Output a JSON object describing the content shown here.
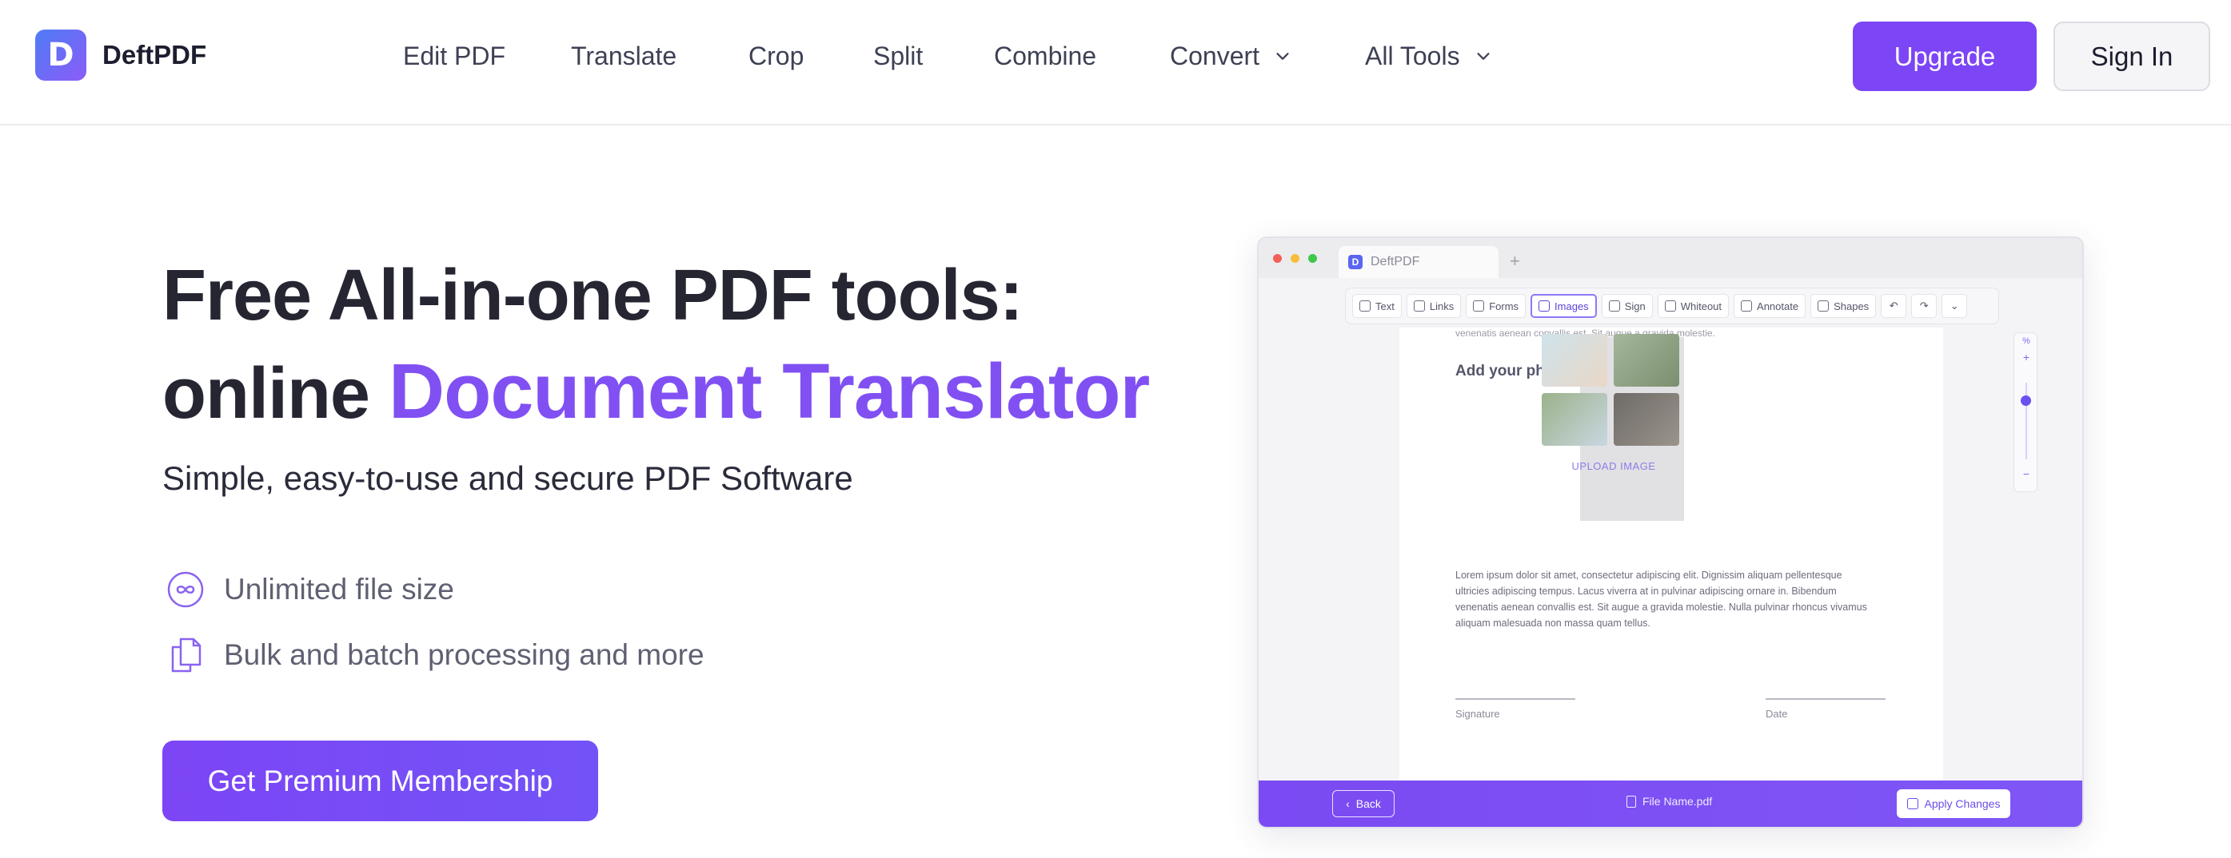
{
  "brand": {
    "name": "DeftPDF",
    "logo_letter": "D"
  },
  "nav": {
    "items": [
      {
        "label": "Edit PDF"
      },
      {
        "label": "Translate"
      },
      {
        "label": "Crop"
      },
      {
        "label": "Split"
      },
      {
        "label": "Combine"
      },
      {
        "label": "Convert",
        "has_dropdown": true
      },
      {
        "label": "All Tools",
        "has_dropdown": true
      }
    ],
    "upgrade_label": "Upgrade",
    "signin_label": "Sign In"
  },
  "hero": {
    "title_line1": "Free All-in-one PDF tools:",
    "title_line2_prefix": "online",
    "title_line2_accent": "Document Translator",
    "subtitle": "Simple, easy-to-use and secure PDF Software",
    "features": [
      {
        "icon": "infinity-icon",
        "text": "Unlimited file size"
      },
      {
        "icon": "documents-icon",
        "text": "Bulk and batch processing and more"
      }
    ],
    "cta_label": "Get Premium Membership"
  },
  "mockup": {
    "tab_name": "DeftPDF",
    "tab_plus": "+",
    "tools": [
      {
        "label": "Text"
      },
      {
        "label": "Links"
      },
      {
        "label": "Forms"
      },
      {
        "label": "Images",
        "active": true
      },
      {
        "label": "Sign"
      },
      {
        "label": "Whiteout"
      },
      {
        "label": "Annotate"
      },
      {
        "label": "Shapes"
      }
    ],
    "tool_undo": "↶",
    "tool_redo": "↷",
    "tool_more": "⌄",
    "doc_cut_text": "venenatis aenean convallis est. Sit augue a gravida molestie.",
    "photo_label": "Add your photo",
    "upload_label": "UPLOAD IMAGE",
    "paragraph": "Lorem ipsum dolor sit amet, consectetur adipiscing elit. Dignissim aliquam pellentesque ultricies adipiscing tempus. Lacus viverra at in pulvinar adipiscing ornare in. Bibendum venenatis aenean convallis est. Sit augue a gravida molestie. Nulla pulvinar rhoncus vivamus aliquam malesuada non massa quam tellus.",
    "signature_label": "Signature",
    "date_label": "Date",
    "zoom_percent": "%",
    "zoom_plus": "+",
    "zoom_minus": "−",
    "back_label": "Back",
    "file_name": "File Name.pdf",
    "apply_label": "Apply Changes"
  },
  "colors": {
    "accent": "#7c45f5",
    "accent_text": "#8150f3",
    "heading": "#262633",
    "muted": "#5f6072"
  }
}
